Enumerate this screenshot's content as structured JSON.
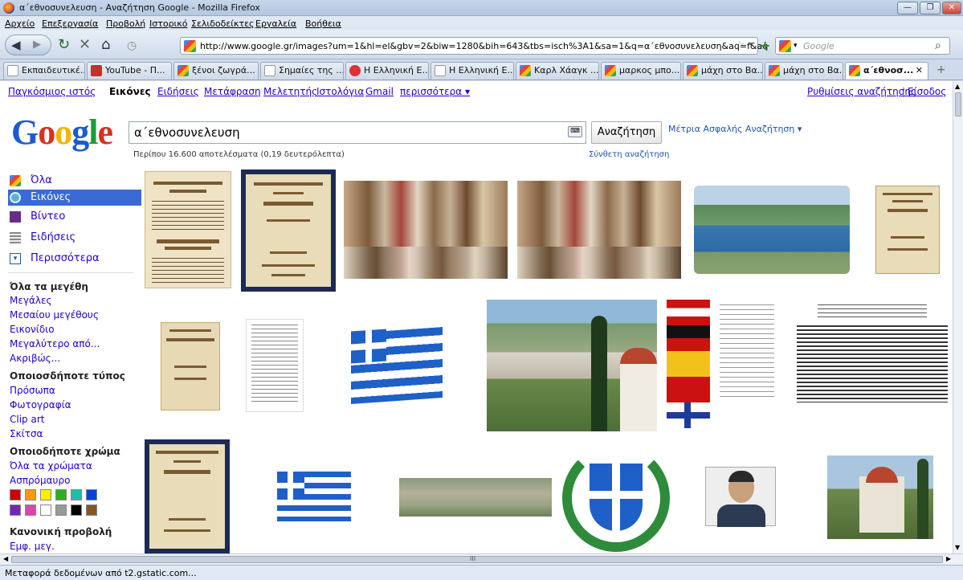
{
  "window": {
    "title": "α΄εθνοσυνελευση - Αναζήτηση Google - Mozilla Firefox"
  },
  "menu": [
    "Αρχείο",
    "Επεξεργασία",
    "Προβολή",
    "Ιστορικό",
    "Σελιδοδείκτες",
    "Εργαλεία",
    "Βοήθεια"
  ],
  "address": {
    "url": "http://www.google.gr/images?um=1&hl=el&gbv=2&biw=1280&bih=643&tbs=isch%3A1&sa=1&q=α΄εθνοσυνελευση&aq=f&aq"
  },
  "search_engine": {
    "placeholder": "Google"
  },
  "tabs": [
    {
      "label": "Εκπαιδευτικέ..."
    },
    {
      "label": "YouTube - Π..."
    },
    {
      "label": "ξένοι ζωγρά..."
    },
    {
      "label": "Σημαίες της ..."
    },
    {
      "label": "Η Ελληνική Ε..."
    },
    {
      "label": "Η Ελληνική Ε..."
    },
    {
      "label": "Καρλ Χάαγκ ..."
    },
    {
      "label": "μαρκος μπο..."
    },
    {
      "label": "μάχη στο Βα..."
    },
    {
      "label": "μάχη στο Βα..."
    },
    {
      "label": "α΄εθνοσ..."
    }
  ],
  "topnav": {
    "links": [
      "Παγκόσμιος ιστός",
      "Εικόνες",
      "Ειδήσεις",
      "Μετάφραση",
      "Μελετητής",
      "Ιστολόγια",
      "Gmail",
      "περισσότερα ▾"
    ],
    "settings": "Ρυθμίσεις αναζήτησης",
    "sep": "|",
    "signin": "Είσοδος"
  },
  "logo": {
    "text": "Google"
  },
  "search": {
    "query": "α΄εθνοσυνελευση",
    "button": "Αναζήτηση",
    "safe": "Μέτρια Ασφαλής Αναζήτηση ▾",
    "results": "Περίπου 16.600 αποτελέσματα (0,19 δευτερόλεπτα)",
    "advanced": "Σύνθετη αναζήτηση"
  },
  "sidebar": {
    "types": [
      {
        "label": "Όλα"
      },
      {
        "label": "Εικόνες"
      },
      {
        "label": "Βίντεο"
      },
      {
        "label": "Ειδήσεις"
      },
      {
        "label": "Περισσότερα"
      }
    ],
    "size_head": "Όλα τα μεγέθη",
    "sizes": [
      "Μεγάλες",
      "Μεσαίου μεγέθους",
      "Εικονίδιο",
      "Μεγαλύτερο από...",
      "Ακριβώς..."
    ],
    "type_head": "Οποιοσδήποτε τύπος",
    "img_types": [
      "Πρόσωπα",
      "Φωτογραφία",
      "Clip art",
      "Σκίτσα"
    ],
    "color_head": "Οποιοδήποτε χρώμα",
    "colors_links": [
      "Όλα τα χρώματα",
      "Ασπρόμαυρο"
    ],
    "swatches": [
      "#cc0000",
      "#ff9900",
      "#ffee00",
      "#33aa22",
      "#22bbaa",
      "#0044dd",
      "#7722bb",
      "#dd44aa",
      "#ffffff",
      "#999999",
      "#000000",
      "#885522"
    ],
    "view_head": "Κανονική προβολή",
    "view_link": "Εμφ. μεγ."
  },
  "statusbar": {
    "text": "Μεταφορά δεδομένων από t2.gstatic.com..."
  },
  "hscroll_mark": "III"
}
